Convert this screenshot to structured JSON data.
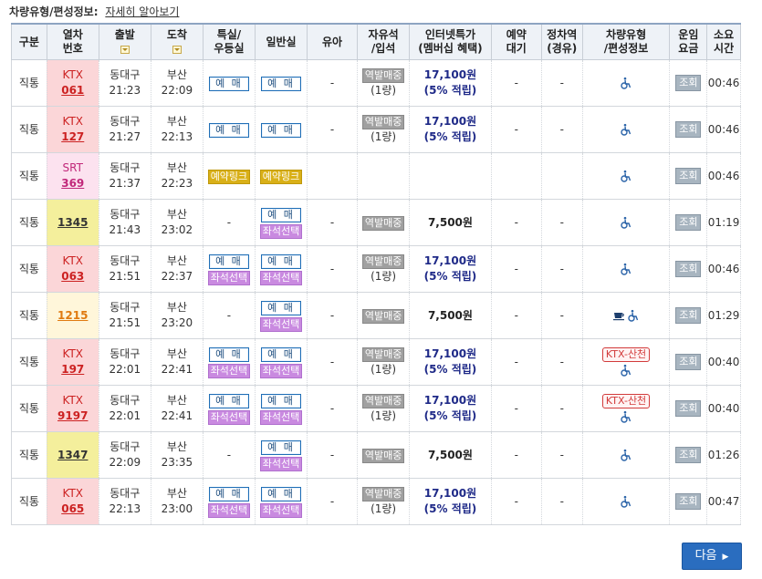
{
  "header": {
    "label": "차량유형/편성정보:",
    "link": "자세히 알아보기"
  },
  "columns": [
    {
      "l1": "구분",
      "l2": ""
    },
    {
      "l1": "열차",
      "l2": "번호"
    },
    {
      "l1": "출발",
      "l2": ""
    },
    {
      "l1": "도착",
      "l2": ""
    },
    {
      "l1": "특실/",
      "l2": "우등실"
    },
    {
      "l1": "일반실",
      "l2": ""
    },
    {
      "l1": "유아",
      "l2": ""
    },
    {
      "l1": "자유석",
      "l2": "/입석"
    },
    {
      "l1": "인터넷특가",
      "l2": "(멤버십 혜택)"
    },
    {
      "l1": "예약",
      "l2": "대기"
    },
    {
      "l1": "정차역",
      "l2": "(경유)"
    },
    {
      "l1": "차량유형",
      "l2": "/편성정보"
    },
    {
      "l1": "운임",
      "l2": "요금"
    },
    {
      "l1": "소요",
      "l2": "시간"
    }
  ],
  "labels": {
    "reserve": "예 매",
    "seat_select": "좌석선택",
    "reserve_link": "예약링크",
    "station_sale": "역발매중",
    "one_car": "(1량)",
    "lookup": "조회",
    "dash": "-",
    "ktx_sancheon": "KTX-산천",
    "next": "다음"
  },
  "rows": [
    {
      "type": "직통",
      "train_type": "KTX",
      "number": "061",
      "dep_station": "동대구",
      "dep_time": "21:23",
      "arr_station": "부산",
      "arr_time": "22:09",
      "price": "17,100원",
      "benefit": "(5% 적립)",
      "duration": "00:46"
    },
    {
      "type": "직통",
      "train_type": "KTX",
      "number": "127",
      "dep_station": "동대구",
      "dep_time": "21:27",
      "arr_station": "부산",
      "arr_time": "22:13",
      "price": "17,100원",
      "benefit": "(5% 적립)",
      "duration": "00:46"
    },
    {
      "type": "직통",
      "train_type": "SRT",
      "number": "369",
      "dep_station": "동대구",
      "dep_time": "21:37",
      "arr_station": "부산",
      "arr_time": "22:23",
      "price": "",
      "benefit": "",
      "duration": "00:46"
    },
    {
      "type": "직통",
      "train_type": "",
      "number": "1345",
      "dep_station": "동대구",
      "dep_time": "21:43",
      "arr_station": "부산",
      "arr_time": "23:02",
      "price": "7,500원",
      "benefit": "",
      "duration": "01:19"
    },
    {
      "type": "직통",
      "train_type": "KTX",
      "number": "063",
      "dep_station": "동대구",
      "dep_time": "21:51",
      "arr_station": "부산",
      "arr_time": "22:37",
      "price": "17,100원",
      "benefit": "(5% 적립)",
      "duration": "00:46"
    },
    {
      "type": "직통",
      "train_type": "",
      "number": "1215",
      "dep_station": "동대구",
      "dep_time": "21:51",
      "arr_station": "부산",
      "arr_time": "23:20",
      "price": "7,500원",
      "benefit": "",
      "duration": "01:29"
    },
    {
      "type": "직통",
      "train_type": "KTX",
      "number": "197",
      "dep_station": "동대구",
      "dep_time": "22:01",
      "arr_station": "부산",
      "arr_time": "22:41",
      "price": "17,100원",
      "benefit": "(5% 적립)",
      "duration": "00:40"
    },
    {
      "type": "직통",
      "train_type": "KTX",
      "number": "9197",
      "dep_station": "동대구",
      "dep_time": "22:01",
      "arr_station": "부산",
      "arr_time": "22:41",
      "price": "17,100원",
      "benefit": "(5% 적립)",
      "duration": "00:40"
    },
    {
      "type": "직통",
      "train_type": "",
      "number": "1347",
      "dep_station": "동대구",
      "dep_time": "22:09",
      "arr_station": "부산",
      "arr_time": "23:35",
      "price": "7,500원",
      "benefit": "",
      "duration": "01:26"
    },
    {
      "type": "직통",
      "train_type": "KTX",
      "number": "065",
      "dep_station": "동대구",
      "dep_time": "22:13",
      "arr_station": "부산",
      "arr_time": "23:00",
      "price": "17,100원",
      "benefit": "(5% 적립)",
      "duration": "00:47"
    }
  ],
  "colors": {
    "ktx_cell": "#fbd6d8",
    "srt_cell": "#fce2ef",
    "mugunghwa_cell": "#f4ef9c",
    "itx_cell": "#fff6da",
    "price_blue": "#1f2a88",
    "next_button": "#2a6dbf"
  },
  "icons": [
    "wheelchair-icon",
    "cafe-icon",
    "sort-icon",
    "chevron-right-icon"
  ]
}
